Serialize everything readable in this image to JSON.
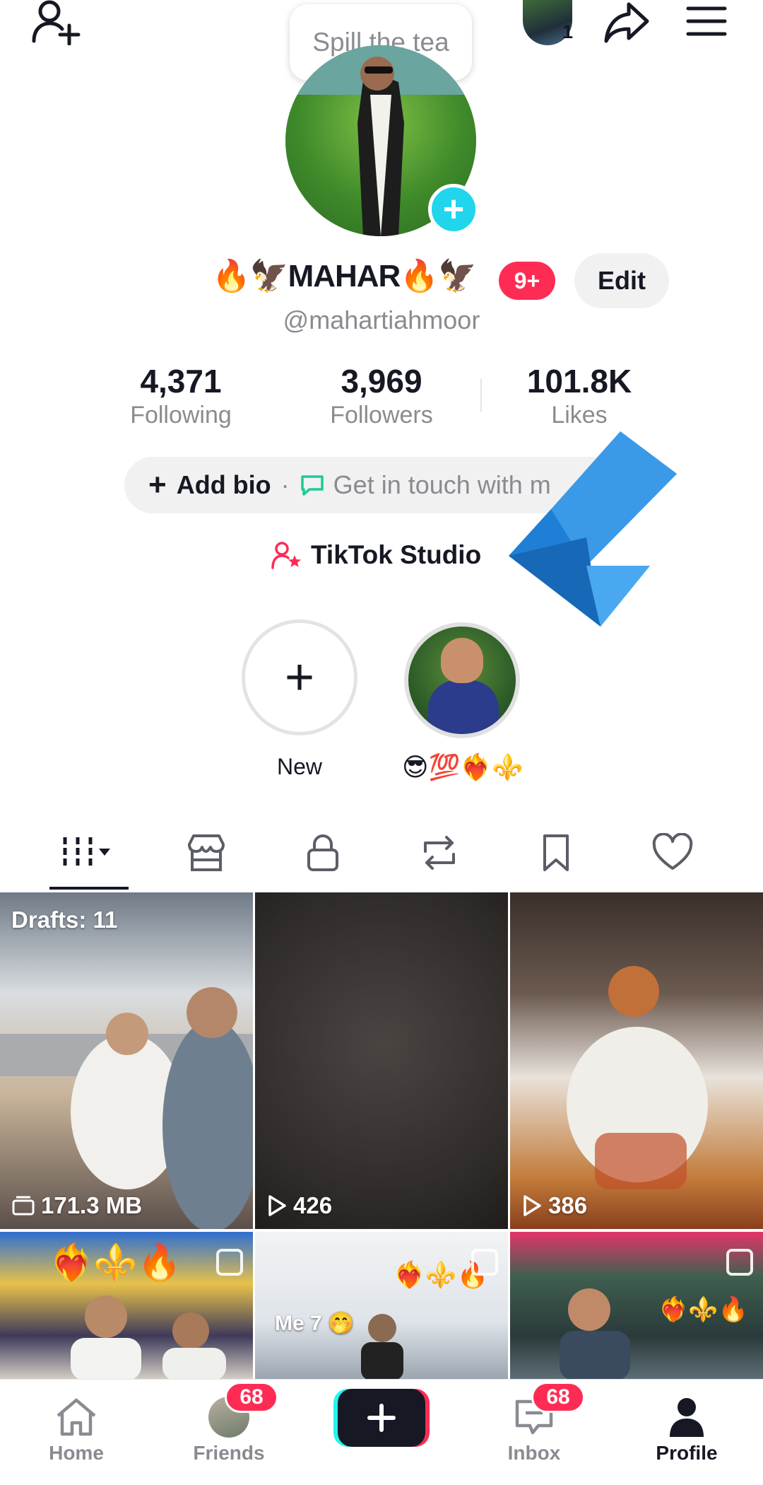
{
  "tooltip": {
    "text": "Spill the tea"
  },
  "top_bar": {
    "avatar_count": "1"
  },
  "profile": {
    "display_name": "🔥🦅MAHAR🔥🦅",
    "username": "@mahartiahmoor",
    "notification_badge": "9+",
    "edit_label": "Edit"
  },
  "stats": [
    {
      "value": "4,371",
      "label": "Following"
    },
    {
      "value": "3,969",
      "label": "Followers"
    },
    {
      "value": "101.8K",
      "label": "Likes"
    }
  ],
  "bio": {
    "add_bio_label": "Add bio",
    "separator": "·",
    "contact_label": "Get in touch with m"
  },
  "studio": {
    "label": "TikTok Studio"
  },
  "highlights": [
    {
      "label": "New"
    },
    {
      "label": "😎💯❤️‍🔥⚜️"
    }
  ],
  "grid": {
    "drafts_label": "Drafts: 11",
    "drafts_size": "171.3 MB",
    "tile2_views": "426",
    "tile3_views": "386",
    "tile4_emoji": "❤️‍🔥⚜️🔥",
    "tile5_caption": "Me 7 🤭",
    "tile5_emoji": "❤️‍🔥⚜️🔥",
    "tile6_emoji": "❤️‍🔥⚜️🔥"
  },
  "bottom_nav": {
    "home": "Home",
    "friends": "Friends",
    "friends_badge": "68",
    "inbox": "Inbox",
    "inbox_badge": "68",
    "profile": "Profile"
  },
  "colors": {
    "accent_red": "#fe2c55",
    "accent_cyan": "#20d5ec",
    "text_primary": "#161823",
    "text_secondary": "#8a8b91"
  }
}
